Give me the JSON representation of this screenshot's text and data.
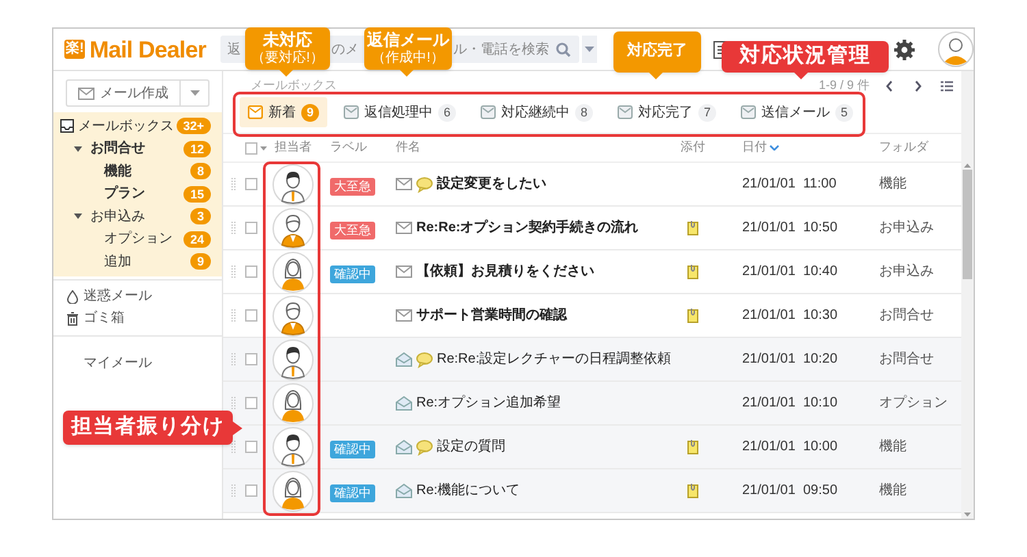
{
  "header": {
    "logo": {
      "mark": "楽!",
      "name": "Mail Dealer"
    },
    "search_visible_text": [
      "返",
      "のメ",
      "ル・電話を検索"
    ]
  },
  "sidebar": {
    "compose_button": "メール作成",
    "tree": [
      {
        "label": "メールボックス",
        "count": "32+",
        "unread": false,
        "children": [
          {
            "label": "お問合せ",
            "count": "12",
            "unread": true,
            "expanded": true,
            "children": [
              {
                "label": "機能",
                "count": "8",
                "unread": true
              },
              {
                "label": "プラン",
                "count": "15",
                "unread": true
              }
            ]
          },
          {
            "label": "お申込み",
            "count": "3",
            "unread": false,
            "expanded": true,
            "children": [
              {
                "label": "オプション",
                "count": "24",
                "unread": false
              },
              {
                "label": "追加",
                "count": "9",
                "unread": false
              }
            ]
          }
        ]
      }
    ],
    "extra_items": [
      {
        "kind": "spam",
        "label": "迷惑メール"
      },
      {
        "kind": "trash",
        "label": "ゴミ箱"
      }
    ],
    "my_mail": "マイメール"
  },
  "main": {
    "breadcrumb": "メールボックス",
    "pager": "1-9 / 9 件",
    "tabs": [
      {
        "label": "新着",
        "count": "9",
        "selected": true
      },
      {
        "label": "返信処理中",
        "count": "6",
        "selected": false
      },
      {
        "label": "対応継続中",
        "count": "8",
        "selected": false
      },
      {
        "label": "対応完了",
        "count": "7",
        "selected": false
      },
      {
        "label": "送信メール",
        "count": "5",
        "selected": false
      }
    ],
    "table": {
      "columns": [
        "担当者",
        "ラベル",
        "件名",
        "添付",
        "日付",
        "フォルダ"
      ],
      "all_checked": false,
      "rows": [
        {
          "avatar": {
            "kind": "man"
          },
          "checked": false,
          "label": {
            "text": "大至急",
            "color": "#f06a6a"
          },
          "unread": true,
          "memo": true,
          "subject": "設定変更をしたい",
          "attachment": false,
          "date": "21/01/01  11:00",
          "folder": "機能"
        },
        {
          "avatar": {
            "kind": "man_vest"
          },
          "checked": false,
          "label": {
            "text": "大至急",
            "color": "#f06a6a"
          },
          "unread": true,
          "memo": false,
          "subject": "Re:Re:オプション契約手続きの流れ",
          "attachment": true,
          "date": "21/01/01  10:50",
          "folder": "お申込み"
        },
        {
          "avatar": {
            "kind": "woman"
          },
          "checked": false,
          "label": {
            "text": "確認中",
            "color": "#3ea6dc"
          },
          "unread": true,
          "memo": false,
          "subject": "【依頼】お見積りをください",
          "attachment": true,
          "date": "21/01/01  10:40",
          "folder": "お申込み"
        },
        {
          "avatar": {
            "kind": "man_vest"
          },
          "checked": false,
          "unread": true,
          "memo": false,
          "subject": "サポート営業時間の確認",
          "attachment": true,
          "date": "21/01/01  10:30",
          "folder": "お問合せ"
        },
        {
          "avatar": {
            "kind": "man"
          },
          "checked": false,
          "unread": false,
          "memo": true,
          "subject": "Re:Re:設定レクチャーの日程調整依頼",
          "attachment": false,
          "date": "21/01/01  10:20",
          "folder": "お問合せ"
        },
        {
          "avatar": {
            "kind": "woman"
          },
          "checked": false,
          "unread": false,
          "memo": false,
          "subject": "Re:オプション追加希望",
          "attachment": false,
          "date": "21/01/01  10:10",
          "folder": "オプション"
        },
        {
          "avatar": {
            "kind": "man"
          },
          "checked": false,
          "label": {
            "text": "確認中",
            "color": "#3ea6dc"
          },
          "unread": false,
          "memo": true,
          "subject": "設定の質問",
          "attachment": true,
          "date": "21/01/01  10:00",
          "folder": "機能"
        },
        {
          "avatar": {
            "kind": "woman"
          },
          "checked": false,
          "label": {
            "text": "確認中",
            "color": "#3ea6dc"
          },
          "unread": false,
          "memo": false,
          "subject": "Re:機能について",
          "attachment": true,
          "date": "21/01/01  09:50",
          "folder": "機能"
        }
      ]
    }
  },
  "annotations": [
    {
      "kind": "orange",
      "title": "未対応",
      "subtitle": "（要対応!）"
    },
    {
      "kind": "orange",
      "title": "返信メール",
      "subtitle": "（作成中!）"
    },
    {
      "kind": "orange",
      "title": "対応完了"
    },
    {
      "kind": "red",
      "title": "対応状況管理"
    },
    {
      "kind": "red_left",
      "title": "担当者振り分け"
    }
  ]
}
